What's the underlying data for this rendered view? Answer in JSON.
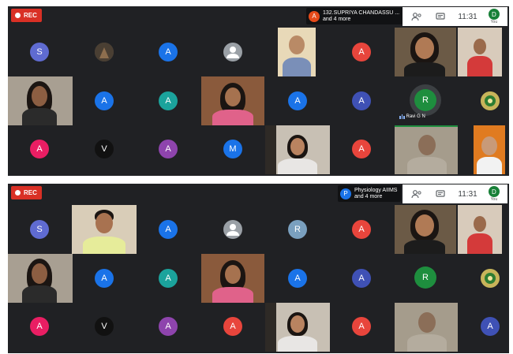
{
  "rec_label": "REC",
  "panels": [
    {
      "presenter": {
        "initial": "A",
        "color": "#e64a19",
        "name": "132.SUPRIYA CHANDASSU ...",
        "more": "and 4 more"
      },
      "time": "11:31",
      "self": {
        "initial": "D",
        "label": "You"
      },
      "speaker": {
        "initial": "R",
        "name": "Ravi G N"
      },
      "avatars": [
        {
          "i": "S",
          "c": "#5f6bd1"
        },
        {
          "i": "A",
          "c": "#1a73e8"
        },
        {
          "i": "A",
          "c": "#e8453c"
        },
        {
          "i": "A",
          "c": "#1a73e8"
        },
        {
          "i": "A",
          "c": "#1ba39c"
        },
        {
          "i": "A",
          "c": "#1a73e8"
        },
        {
          "i": "A",
          "c": "#3f51b5"
        },
        {
          "i": "A",
          "c": "#e91e63"
        },
        {
          "i": "V",
          "c": "#111111"
        },
        {
          "i": "A",
          "c": "#8e44ad"
        },
        {
          "i": "M",
          "c": "#1a73e8"
        },
        {
          "i": "A",
          "c": "#e8453c"
        }
      ]
    },
    {
      "presenter": {
        "initial": "P",
        "color": "#1a73e8",
        "name": "Physiology AIIMS",
        "more": "and 4 more"
      },
      "time": "11:31",
      "self": {
        "initial": "D",
        "label": "You"
      },
      "speaker": {
        "initial": "R",
        "name": ""
      },
      "avatars": [
        {
          "i": "S",
          "c": "#5f6bd1"
        },
        {
          "i": "A",
          "c": "#1a73e8"
        },
        {
          "i": "R",
          "c": "#7aa0bf"
        },
        {
          "i": "A",
          "c": "#e8453c"
        },
        {
          "i": "A",
          "c": "#1a73e8"
        },
        {
          "i": "A",
          "c": "#1ba39c"
        },
        {
          "i": "A",
          "c": "#1a73e8"
        },
        {
          "i": "A",
          "c": "#3f51b5"
        },
        {
          "i": "A",
          "c": "#e91e63"
        },
        {
          "i": "V",
          "c": "#111111"
        },
        {
          "i": "A",
          "c": "#8e44ad"
        },
        {
          "i": "A",
          "c": "#e8453c"
        },
        {
          "i": "A",
          "c": "#e8453c"
        },
        {
          "i": "A",
          "c": "#3f51b5"
        }
      ]
    }
  ]
}
